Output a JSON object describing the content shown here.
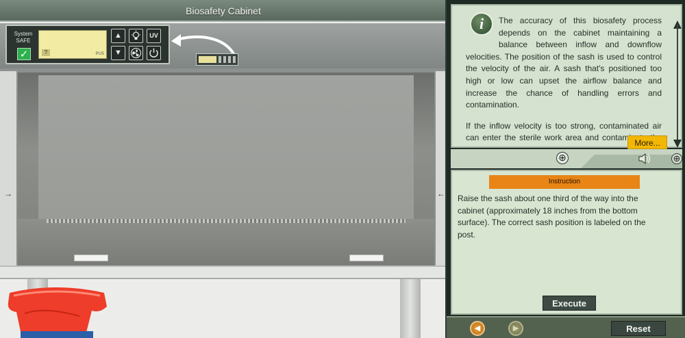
{
  "scene": {
    "title": "Biosafety Cabinet"
  },
  "control_panel": {
    "status_line1": "System",
    "status_line2": "SAFE",
    "status_check": "✓",
    "lcd_help": "?",
    "lcd_tag": "PUS",
    "buttons": [
      {
        "name": "up-arrow-button",
        "icon": "▲"
      },
      {
        "name": "light-button",
        "icon": "light-bulb-icon"
      },
      {
        "name": "uv-button",
        "icon": "UV"
      },
      {
        "name": "down-arrow-button",
        "icon": "▼"
      },
      {
        "name": "fan-button",
        "icon": "fan-icon"
      },
      {
        "name": "power-button",
        "icon": "power-icon"
      }
    ]
  },
  "info": {
    "paragraph1": "The accuracy of this biosafety process depends on the cabinet maintaining a balance between inflow and downflow velocities. The position of the sash is used to control the velocity of the air. A sash that's positioned too high or low can upset the airflow balance and increase the chance of handling errors and contamination.",
    "paragraph2": "If the inflow velocity is too strong, contaminated air can enter the sterile work area and contaminate the work. Excessive d",
    "more_label": "More..."
  },
  "tabs": {
    "expand_symbol": "⊕",
    "plus_symbol": "⊕"
  },
  "instruction": {
    "header": "Instruction",
    "text": "Raise the sash about one third of the way into the cabinet (approximately 18 inches from the bottom surface). The correct sash position is labeled on the post.",
    "execute_label": "Execute"
  },
  "footer": {
    "reset_label": "Reset"
  },
  "colors": {
    "accent_orange": "#e88516",
    "more_yellow": "#f2b705",
    "panel_green": "#d5e2cf",
    "safe_green": "#2bb24c"
  }
}
